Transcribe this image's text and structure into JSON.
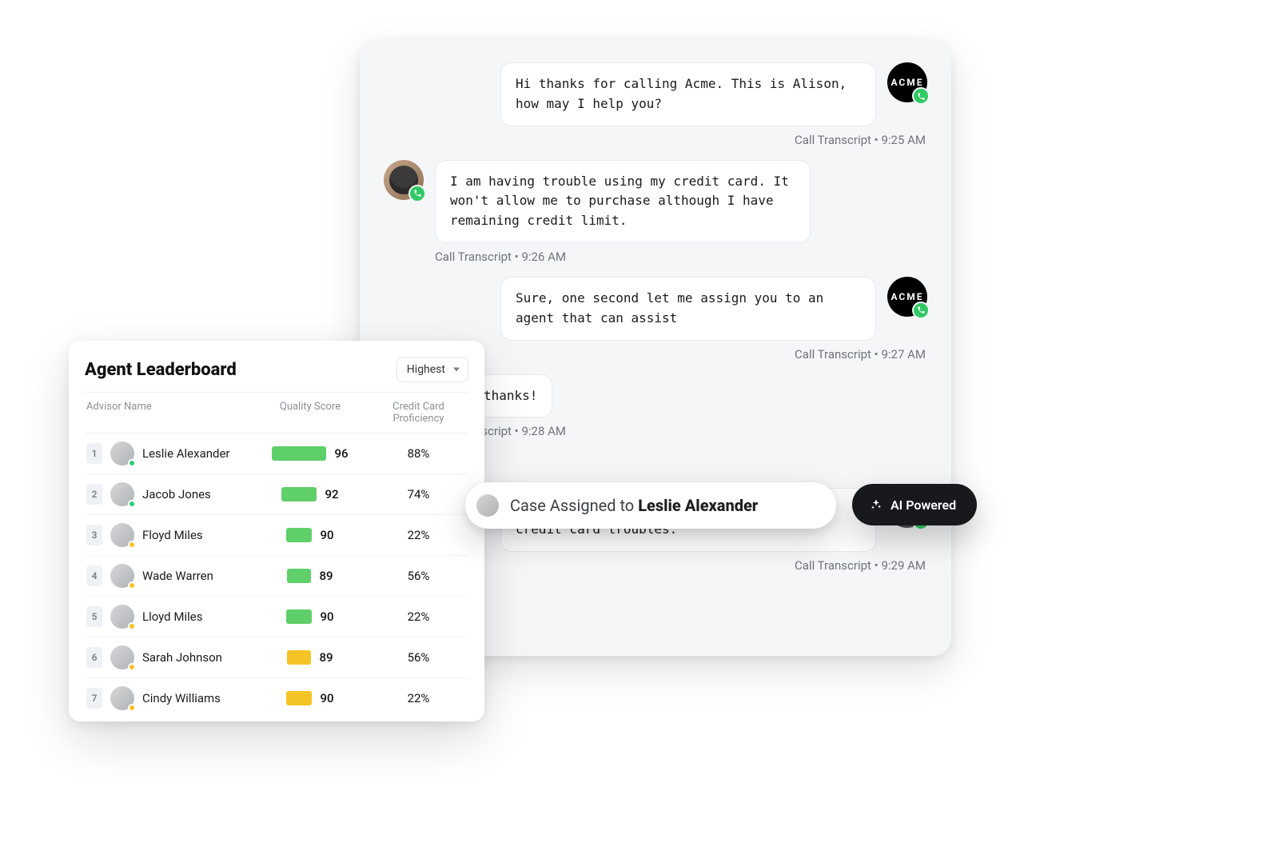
{
  "chat": {
    "transcript_label": "Call Transcript",
    "messages": [
      {
        "side": "agent",
        "avatar": "acme",
        "text": "Hi thanks for calling Acme. This is Alison, how may I help you?",
        "time": "9:25 AM"
      },
      {
        "side": "customer",
        "avatar": "photo",
        "text": "I am having trouble using my credit card. It won't allow me to purchase although I have remaining credit limit.",
        "time": "9:26 AM"
      },
      {
        "side": "agent",
        "avatar": "acme",
        "text": "Sure, one second let me assign you to an agent that can assist",
        "time": "9:27 AM"
      },
      {
        "side": "customer",
        "avatar": "none",
        "text": "Ok awesome thanks!",
        "time": "9:28 AM",
        "partial": true
      },
      {
        "side": "agent",
        "avatar": "photo2",
        "text": "Hi! I'm Leslie, I can help you with your credit card troubles.",
        "time": "9:29 AM"
      }
    ],
    "assignment": {
      "prefix": "Case Assigned to ",
      "name": "Leslie Alexander"
    },
    "ai_badge": "AI Powered",
    "acme_label": "ACME"
  },
  "leaderboard": {
    "title": "Agent Leaderboard",
    "sort_label": "Highest",
    "columns": {
      "name": "Advisor Name",
      "score": "Quality Score",
      "proficiency": "Credit Card Proficiency"
    },
    "rows": [
      {
        "rank": "1",
        "name": "Leslie Alexander",
        "status": "online",
        "score": 96,
        "bar": "green",
        "bw": "w96",
        "proficiency": "88%"
      },
      {
        "rank": "2",
        "name": "Jacob Jones",
        "status": "online",
        "score": 92,
        "bar": "green",
        "bw": "w92",
        "proficiency": "74%"
      },
      {
        "rank": "3",
        "name": "Floyd Miles",
        "status": "away",
        "score": 90,
        "bar": "green",
        "bw": "w90",
        "proficiency": "22%"
      },
      {
        "rank": "4",
        "name": "Wade Warren",
        "status": "away",
        "score": 89,
        "bar": "green",
        "bw": "w89",
        "proficiency": "56%"
      },
      {
        "rank": "5",
        "name": "Lloyd Miles",
        "status": "away",
        "score": 90,
        "bar": "green",
        "bw": "w90",
        "proficiency": "22%"
      },
      {
        "rank": "6",
        "name": "Sarah Johnson",
        "status": "away",
        "score": 89,
        "bar": "amber",
        "bw": "w89",
        "proficiency": "56%"
      },
      {
        "rank": "7",
        "name": "Cindy Williams",
        "status": "away",
        "score": 90,
        "bar": "amber",
        "bw": "w90",
        "proficiency": "22%"
      }
    ]
  }
}
